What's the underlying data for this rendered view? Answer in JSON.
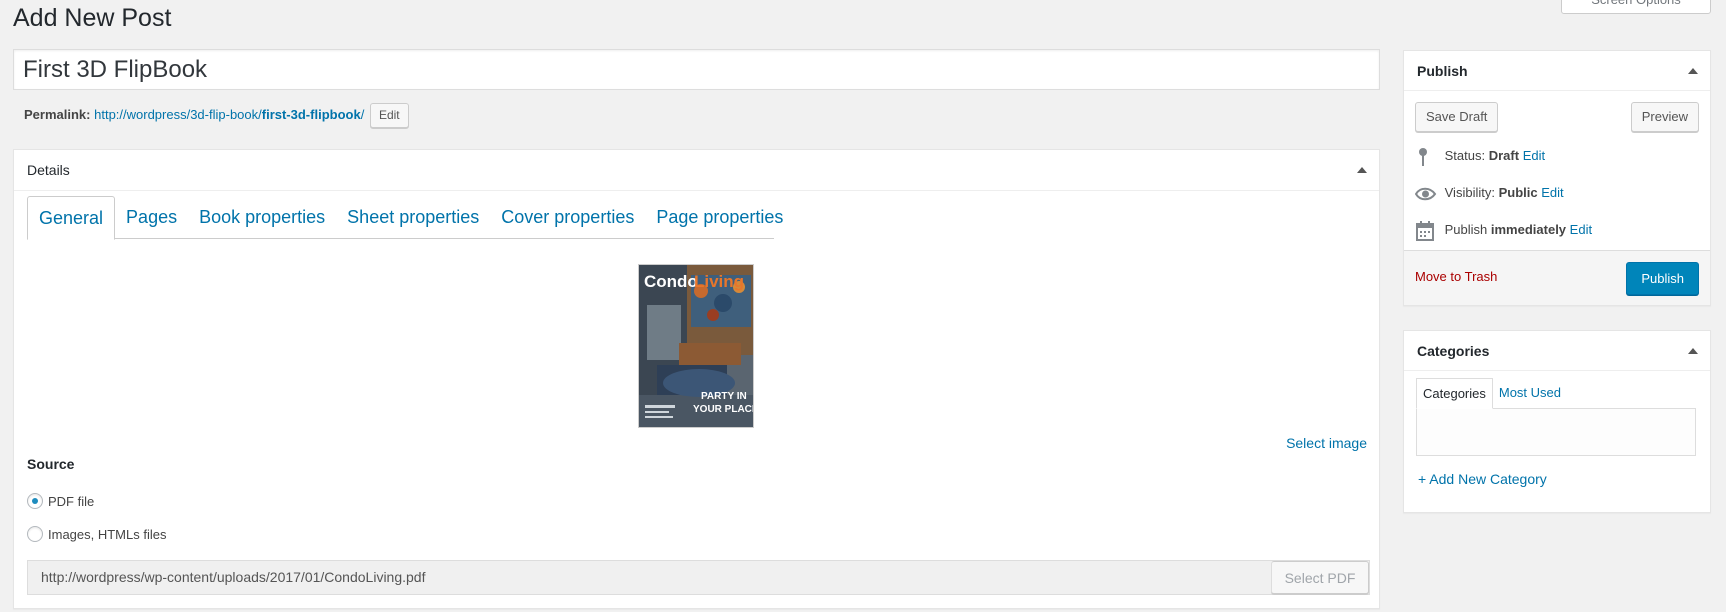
{
  "header": {
    "title": "Add New Post",
    "screen_options": "Screen Options"
  },
  "post": {
    "title": "First 3D FlipBook",
    "permalink_label": "Permalink:",
    "permalink_base": "http://wordpress/3d-flip-book/",
    "permalink_slug": "first-3d-flipbook",
    "permalink_end": "/",
    "edit_label": "Edit"
  },
  "details": {
    "heading": "Details",
    "tabs": [
      "General",
      "Pages",
      "Book properties",
      "Sheet properties",
      "Cover properties",
      "Page properties"
    ],
    "active_tab": "General",
    "cover": {
      "brand_a": "Condo",
      "brand_b": "Living",
      "headline_1": "PARTY IN",
      "headline_2": "YOUR PLACE"
    },
    "select_image": "Select image",
    "source_label": "Source",
    "source_options": [
      {
        "label": "PDF file",
        "checked": true
      },
      {
        "label": "Images, HTMLs files",
        "checked": false
      }
    ],
    "pdf_url": "http://wordpress/wp-content/uploads/2017/01/CondoLiving.pdf",
    "select_pdf": "Select PDF"
  },
  "publish": {
    "heading": "Publish",
    "save_draft": "Save Draft",
    "preview": "Preview",
    "status_label": "Status:",
    "status_value": "Draft",
    "visibility_label": "Visibility:",
    "visibility_value": "Public",
    "publish_label": "Publish",
    "publish_value": "immediately",
    "edit": "Edit",
    "move_to_trash": "Move to Trash",
    "publish_button": "Publish"
  },
  "categories": {
    "heading": "Categories",
    "tabs": [
      "Categories",
      "Most Used"
    ],
    "add_new": "+ Add New Category"
  },
  "colors": {
    "link": "#0073aa",
    "primary_button": "#0085ba",
    "trash": "#a00000",
    "background": "#f1f1f1"
  }
}
